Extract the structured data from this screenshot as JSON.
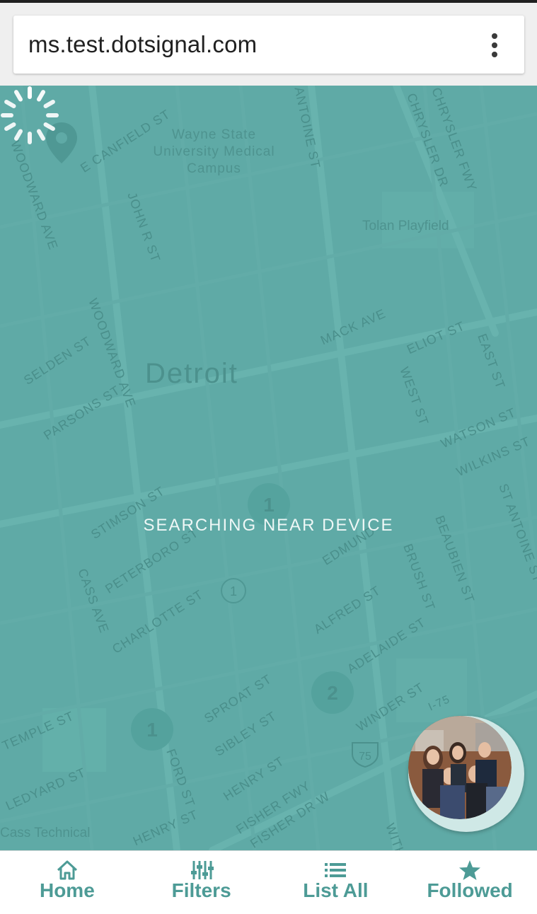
{
  "browser": {
    "url": "ms.test.dotsignal.com",
    "menu_icon": "more-vert-icon"
  },
  "map": {
    "city": "Detroit",
    "poi": [
      "Wayne State University Medical Campus",
      "Tolan Playfield",
      "Cass Technical"
    ],
    "streets": [
      "E CANFIELD ST",
      "WOODWARD AVE",
      "JOHN R ST",
      "CHRYSLER DR",
      "CHRYSLER FWY",
      "MACK AVE",
      "ELIOT ST",
      "EAST ST",
      "SELDEN ST",
      "WOODWARD AVE",
      "PARSONS ST",
      "WEST ST",
      "WATSON ST",
      "WILKINS ST",
      "ST ANTOINE ST",
      "STIMSON ST",
      "PETERBORO ST",
      "BEAUBIEN ST",
      "BRUSH ST",
      "EDMUND",
      "CASS AVE",
      "CHARLOTTE ST",
      "ALFRED ST",
      "ADELAIDE ST",
      "SPROAT ST",
      "WINDER ST",
      "SIBLEY ST",
      "HENRY ST",
      "FISHER FWY",
      "LEDYARD ST",
      "HENRY ST",
      "FISHER DR W",
      "TEMPLE ST",
      "FORD ST",
      "ANTOINE ST",
      "WITHER"
    ],
    "markers": [
      "1",
      "1",
      "2",
      "1"
    ],
    "highway_shield": "75",
    "highway_label": "I-75",
    "status_text": "SEARCHING NEAR DEVICE"
  },
  "nav": {
    "items": [
      {
        "label": "Home",
        "icon": "home-icon"
      },
      {
        "label": "Filters",
        "icon": "filters-icon"
      },
      {
        "label": "List All",
        "icon": "list-icon"
      },
      {
        "label": "Followed",
        "icon": "star-icon"
      }
    ]
  },
  "colors": {
    "map_teal": "#5faaa6",
    "accent": "#4d9b96",
    "browser_bar": "#efefef"
  }
}
